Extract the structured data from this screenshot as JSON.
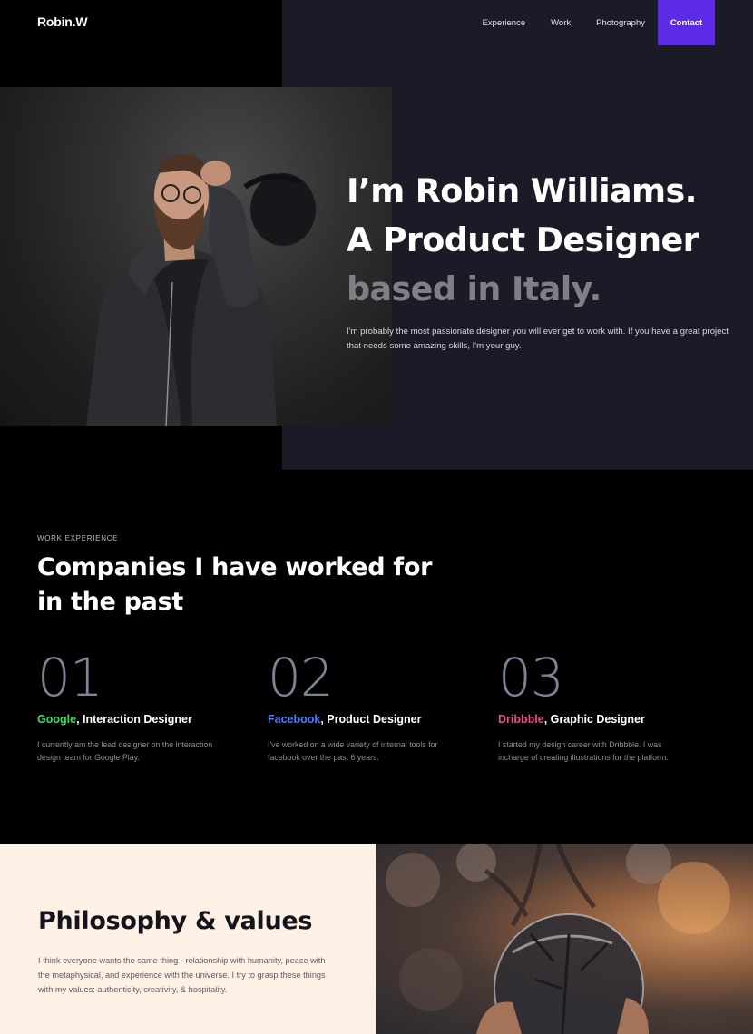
{
  "header": {
    "logo": "Robin.W",
    "nav": [
      "Experience",
      "Work",
      "Photography"
    ],
    "contact_label": "Contact",
    "accent": "#5b2be6"
  },
  "hero": {
    "title_line1": "I’m Robin Williams.",
    "title_line2": "A Product Designer",
    "title_line3": "based in Italy.",
    "subtitle": "I'm probably the most passionate designer you will ever get to work with. If you have a great project that needs some amazing skills, I'm your guy."
  },
  "experience": {
    "eyebrow": "WORK EXPERIENCE",
    "title": "Companies I have worked for in the past",
    "items": [
      {
        "number": "01",
        "company": "Google",
        "company_color": "#3ddc5e",
        "role": ", Interaction Designer",
        "description": "I currently am the lead designer on the interaction design team for Google Play."
      },
      {
        "number": "02",
        "company": "Facebook",
        "company_color": "#4a7dff",
        "role": ", Product Designer",
        "description": "I've worked on a wide variety of internal tools for facebook over the past 6 years."
      },
      {
        "number": "03",
        "company": "Dribbble",
        "company_color": "#ea4c89",
        "role": ", Graphic Designer",
        "description": "I started my design career with Dribbble. I was incharge of creating illustrations for the platform."
      }
    ]
  },
  "philosophy": {
    "title": "Philosophy & values",
    "text": "I think everyone wants the same thing - relationship with humanity, peace with the metaphysical, and experience with the universe. I try to grasp these things with my values: authenticity, creativity, & hospitality."
  }
}
